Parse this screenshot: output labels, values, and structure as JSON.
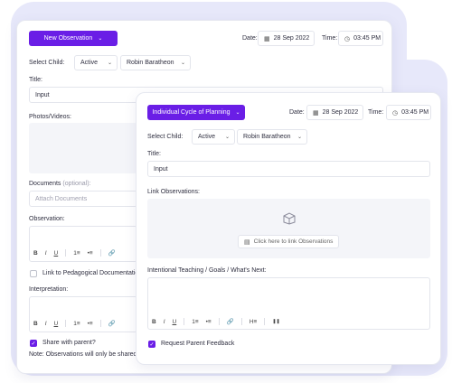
{
  "back": {
    "new_observation_label": "New Observation",
    "date_label": "Date:",
    "date_value": "28 Sep 2022",
    "time_label": "Time:",
    "time_value": "03:45 PM",
    "select_child_label": "Select Child:",
    "status_value": "Active",
    "child_value": "Robin Baratheon",
    "title_label": "Title:",
    "title_value": "Input",
    "photos_label": "Photos/Videos:",
    "documents_label": "Documents",
    "documents_optional": "(optional):",
    "attach_placeholder": "Attach Documents",
    "observation_label": "Observation:",
    "link_pedagogical_label": "Link to Pedagogical Documentatio",
    "interpretation_label": "Interpretation:",
    "share_label": "Share with parent?",
    "note_text": "Note: Observations will only be shared"
  },
  "front": {
    "cycle_label": "Individual Cycle of Planning",
    "date_label": "Date:",
    "date_value": "28 Sep 2022",
    "time_label": "Time:",
    "time_value": "03:45 PM",
    "select_child_label": "Select Child:",
    "status_value": "Active",
    "child_value": "Robin Baratheon",
    "title_label": "Title:",
    "title_value": "Input",
    "link_observations_label": "Link Observations:",
    "link_observations_button": "Click here to link Observations",
    "intentional_label": "Intentional Teaching / Goals / What's Next:",
    "request_feedback_label": "Request Parent Feedback"
  },
  "toolbar": {
    "bold": "B",
    "italic": "I",
    "underline": "U",
    "ordered_list": "1≡",
    "bullet_list": "•≡",
    "link": "🔗",
    "heading": "H≡",
    "pause": "❚❚"
  },
  "colors": {
    "accent": "#6a1ee6",
    "background_blob": "#e7e8fa"
  }
}
